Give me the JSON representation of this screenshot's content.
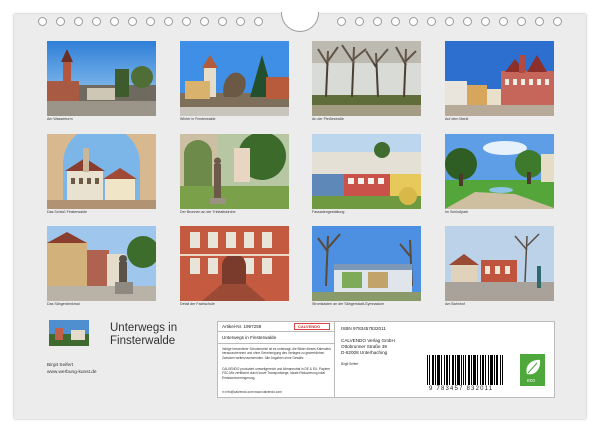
{
  "calendar": {
    "title_line1": "Unterwegs in",
    "title_line2": "Finsterwalde",
    "author_name": "Birgit Seifert",
    "author_url": "www.werbung-kunst.de"
  },
  "photos": [
    {
      "caption": "Am Wasserturm"
    },
    {
      "caption": "Winter in Finsterwalde"
    },
    {
      "caption": "An der Pleißestraße"
    },
    {
      "caption": "Auf dem Markt"
    },
    {
      "caption": "Das Schloß Finsterwalde"
    },
    {
      "caption": "Der Brunnen an der Trinitatiskirche"
    },
    {
      "caption": "Fassadengestaltung"
    },
    {
      "caption": "Im Schloßpark"
    },
    {
      "caption": "Das Sängerdenkmal"
    },
    {
      "caption": "Detail der Fachschule"
    },
    {
      "caption": "Stromkasten an der Sängerstadt-Gymnasium"
    },
    {
      "caption": "Am Bahnhof"
    }
  ],
  "info_box": {
    "article_label": "Artikel-Nr. 1997259",
    "brand": "CALVENDO",
    "product_title": "Unterwegs in Finsterwalde",
    "isbn": "ISBN 9783457832011",
    "publisher_line1": "CALVENDO Verlag GmbH",
    "publisher_line2": "Ottobrunner Straße 39",
    "publisher_line3": "D-82008 Unterhaching",
    "author_short": "Birgit Seifert",
    "description1": "Infolge besonderer Schutzrechte ist es untersagt, die Bilder dieses Kalenders herauszutrennen und ohne Genehmigung des Verlages zu gewerblichen Zwecken weiterzuverwenden. Alle Angaben ohne Gewähr.",
    "description2": "CALVENDO produziert umweltgerecht und klimaneutral in DE & EU. Papiere FSC-Mix zertifiziert durch kurze Transportwege, lokale Reduzierung lokal Emissionsverringerung.",
    "contact": "✉ info@calvendo.com    www.calvendo.com",
    "barcode_digits": "9 783457 832011",
    "eco_label": "eco"
  },
  "colors": {
    "page_background": "#ebeceb",
    "eco_green": "#4ea83b"
  }
}
